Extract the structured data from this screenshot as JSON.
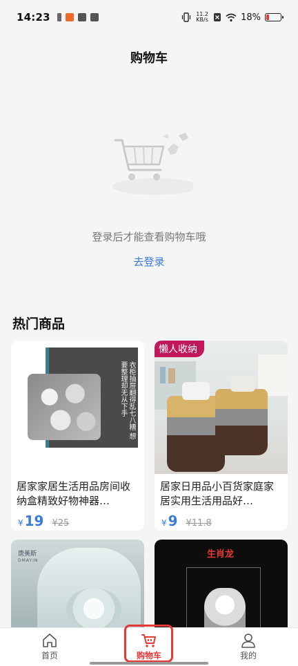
{
  "status_bar": {
    "time": "14:23",
    "net_speed_value": "11.2",
    "net_speed_unit": "KB/s",
    "battery": "18%",
    "battery_level": 0.18
  },
  "header": {
    "title": "购物车"
  },
  "empty_cart": {
    "illustration": "shopping-cart-illustration",
    "message": "登录后才能查看购物车哦",
    "login_link": "去登录"
  },
  "hot": {
    "title": "热门商品",
    "products": [
      {
        "name": "居家家居生活用品房间收纳盒精致好物神器…",
        "currency": "¥",
        "price": "19",
        "original_price": "¥25",
        "image_text": "衣柜抽屉翻得乱七八糟 想要整理却无从下手"
      },
      {
        "name": "居家日用品小百货家庭家居实用生活用品好…",
        "currency": "¥",
        "price": "9",
        "original_price": "¥11.8",
        "tag": "懒人收纳"
      },
      {
        "image_text": "唐美斯",
        "image_subtext": "DMAYIN"
      },
      {
        "image_text": "生肖龙"
      }
    ]
  },
  "bottom_nav": [
    {
      "label": "首页",
      "icon": "home-icon"
    },
    {
      "label": "购物车",
      "icon": "cart-icon",
      "active": true
    },
    {
      "label": "我的",
      "icon": "user-icon"
    }
  ],
  "colors": {
    "accent": "#e53935",
    "link": "#3a7bd5",
    "tag": "#c2185b"
  }
}
